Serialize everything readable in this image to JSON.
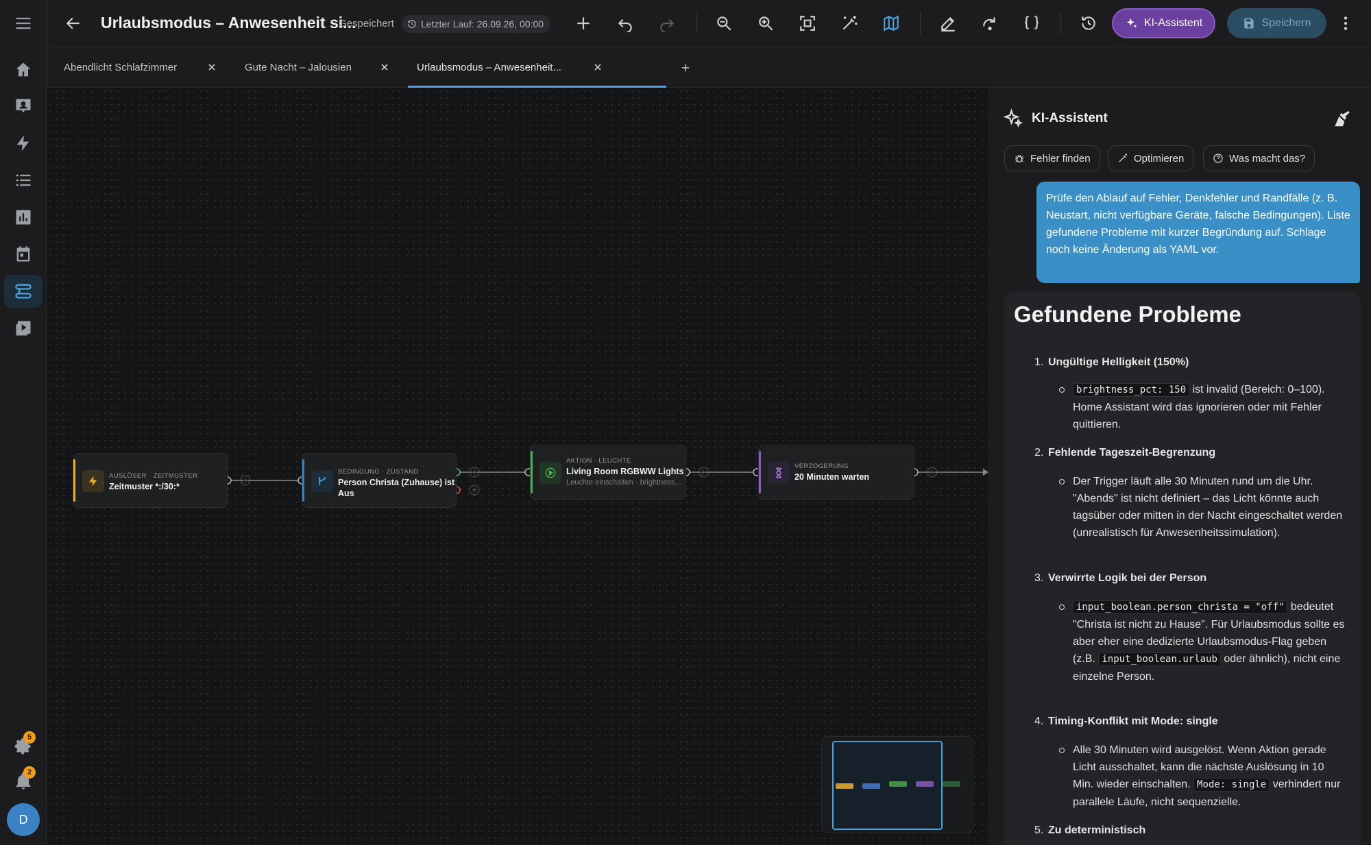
{
  "app": {
    "title": "Urlaubsmodus – Anwesenheit si...",
    "save_status": "Gespeichert",
    "last_run": "Letzter Lauf: 26.09.26, 00:00",
    "ki_button": "KI-Assistent",
    "save_button": "Speichern"
  },
  "sidebar": {
    "settings_badge": "5",
    "notifications_badge": "2",
    "avatar_initial": "D"
  },
  "tabs": [
    {
      "label": "Abendlicht Schlafzimmer"
    },
    {
      "label": "Gute Nacht – Jalousien"
    },
    {
      "label": "Urlaubsmodus – Anwesenheit..."
    }
  ],
  "nodes": [
    {
      "type": "Auslöser · Zeitmuster",
      "name": "Zeitmuster *:/30:*",
      "color": "#f2b01e"
    },
    {
      "type": "Bedingung · Zustand",
      "name_line1": "Person Christa (Zuhause) ist",
      "name_line2": "Aus",
      "color": "#3b82c4"
    },
    {
      "type": "Aktion · Leuchte",
      "name": "Living Room RGBWW Lights",
      "sub": "Leuchte einschalten · brightness...",
      "color": "#4caf50"
    },
    {
      "type": "Verzögerung",
      "name": "20 Minuten warten",
      "color": "#8e5ac4"
    }
  ],
  "assistant": {
    "title": "KI-Assistent",
    "chips": [
      "Fehler finden",
      "Optimieren",
      "Was macht das?"
    ],
    "user_message": "Prüfe den Ablauf auf Fehler, Denkfehler und Randfälle (z. B. Neustart, nicht verfügbare Geräte, falsche Bedingungen). Liste gefundene Probleme mit kurzer Begründung auf. Schlage noch keine Änderung als YAML vor.",
    "reply_title": "Gefundene Probleme",
    "problems": [
      {
        "num": "1.",
        "head": "Ungültige Helligkeit (150%)",
        "code": "brightness_pct: 150",
        "text_a": "ist invalid (Bereich: 0–100). Home Assistant wird das ignorieren oder mit Fehler quittieren."
      },
      {
        "num": "2.",
        "head": "Fehlende Tageszeit-Begrenzung",
        "text_a": "Der Trigger läuft alle 30 Minuten rund um die Uhr. \"Abends\" ist nicht definiert – das Licht könnte auch tagsüber oder mitten in der Nacht eingeschaltet werden (unrealistisch für Anwesenheitssimulation)."
      },
      {
        "num": "3.",
        "head": "Verwirrte Logik bei der Person",
        "code": "input_boolean.person_christa = \"off\"",
        "text_a": "bedeutet \"Christa ist nicht zu Hause\". Für Urlaubsmodus sollte es aber eher eine dedizierte Urlaubsmodus-Flag geben (z.B.",
        "code2": "input_boolean.urlaub",
        "text_b": "oder ähnlich), nicht eine einzelne Person."
      },
      {
        "num": "4.",
        "head": "Timing-Konflikt mit Mode: single",
        "text_a": "Alle 30 Minuten wird ausgelöst. Wenn Aktion gerade Licht ausschaltet, kann die nächste Auslösung in 10 Min. wieder einschalten.",
        "code": "Mode: single",
        "text_b": "verhindert nur parallele Läufe, nicht sequenzielle."
      },
      {
        "num": "5.",
        "head": "Zu deterministisch"
      }
    ]
  },
  "minimap": {
    "colors": [
      "#c99a2e",
      "#3b6fb0",
      "#3f8f45",
      "#7a52a8",
      "#2f5c38"
    ]
  }
}
